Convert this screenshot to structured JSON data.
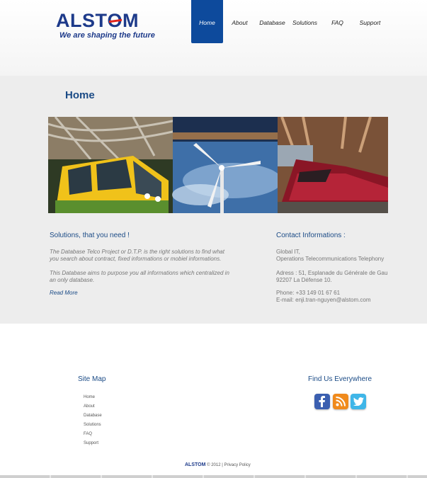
{
  "brand": {
    "logo_text_pre": "ALST",
    "logo_text_o": "O",
    "logo_text_post": "M",
    "tagline": "We are shaping the future"
  },
  "nav": {
    "home": "Home",
    "about": "About",
    "database": "Database",
    "solutions": "Solutions",
    "faq": "FAQ",
    "support": "Support"
  },
  "main": {
    "title": "Home",
    "solutions_heading": "Solutions, that you need !",
    "intro_line1": "The Database Telco Project or D.T.P. is the right solutions to find what",
    "intro_line2": "you search about contract, fixed informations or mobiel informations.",
    "purpose_line1": "This Database aims to purpose you all informations which centralized in",
    "purpose_line2": "an only database.",
    "read_more": "Read More"
  },
  "contact": {
    "heading": "Contact Informations :",
    "org_line1": "Global IT,",
    "org_line2": "Operations Telecommunications Telephony",
    "address_line1": "Adress : 51, Esplanade du Générale de Gau",
    "address_line2": "92207 La Défense 10.",
    "phone": "Phone: +33 149 01 67 61",
    "email": "E-mail: enji.tran-nguyen@alstom.com"
  },
  "footer": {
    "sitemap_heading": "Site Map",
    "sitemap_links": [
      "Home",
      "About",
      "Database",
      "Solutions",
      "FAQ",
      "Support"
    ],
    "social_heading": "Find Us Everywhere",
    "social_icons": [
      "facebook-icon",
      "rss-icon",
      "twitter-icon"
    ],
    "copyright_logo": "ALSTOM",
    "copyright_text": "© 2012 | Privacy Policy"
  },
  "colors": {
    "brand_blue": "#1d3a8a",
    "nav_active": "#0d4a9c",
    "heading_blue": "#1b4b86",
    "logo_red": "#e2231a"
  }
}
